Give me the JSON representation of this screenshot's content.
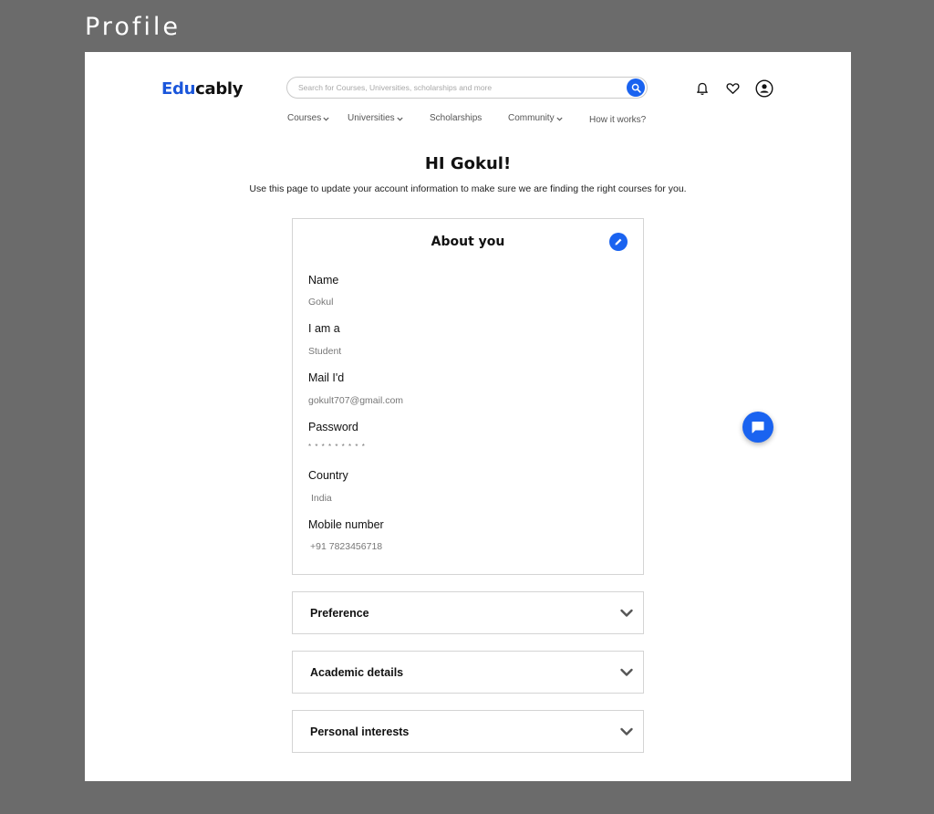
{
  "frame": {
    "title": "Profile"
  },
  "brand": {
    "logo_accent": "Edu",
    "logo_rest": "cably",
    "accent_color": "#1a56db"
  },
  "search": {
    "placeholder": "Search for Courses, Universities, scholarships and more",
    "icon": "search-icon"
  },
  "header_icons": [
    "bell-icon",
    "heart-icon",
    "user-icon"
  ],
  "nav": {
    "items": [
      {
        "label": "Courses",
        "dropdown": true
      },
      {
        "label": "Universities",
        "dropdown": true
      },
      {
        "label": "Scholarships",
        "dropdown": false
      },
      {
        "label": "Community",
        "dropdown": true
      },
      {
        "label": "How it works?",
        "dropdown": false
      }
    ]
  },
  "greeting": "HI Gokul!",
  "subtitle": "Use this page to update your account information to make sure we are finding the right courses for you.",
  "about": {
    "title": "About you",
    "edit_icon": "pencil-icon",
    "fields": [
      {
        "label": "Name",
        "value": "Gokul"
      },
      {
        "label": "I am a",
        "value": "Student"
      },
      {
        "label": "Mail I'd",
        "value": "gokult707@gmail.com"
      },
      {
        "label": "Password",
        "value": "* * * * * * * * *"
      },
      {
        "label": "Country",
        "value": "India"
      },
      {
        "label": "Mobile  number",
        "value": "+91 7823456718"
      }
    ]
  },
  "sections": [
    {
      "title": "Preference"
    },
    {
      "title": "Academic details"
    },
    {
      "title": "Personal interests"
    }
  ],
  "chat": {
    "icon": "chat-icon"
  },
  "colors": {
    "primary": "#1a63f0",
    "background": "#6b6b6b",
    "card_border": "#d4d4d4"
  }
}
